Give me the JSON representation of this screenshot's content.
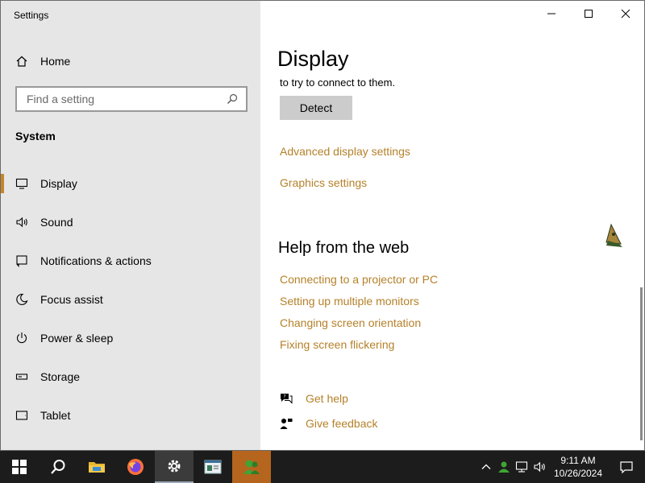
{
  "window": {
    "title": "Settings"
  },
  "sidebar": {
    "home_label": "Home",
    "search_placeholder": "Find a setting",
    "section_label": "System",
    "items": [
      {
        "label": "Display",
        "icon": "monitor-icon",
        "active": true
      },
      {
        "label": "Sound",
        "icon": "speaker-icon"
      },
      {
        "label": "Notifications & actions",
        "icon": "notification-icon"
      },
      {
        "label": "Focus assist",
        "icon": "moon-icon"
      },
      {
        "label": "Power & sleep",
        "icon": "power-icon"
      },
      {
        "label": "Storage",
        "icon": "storage-icon"
      },
      {
        "label": "Tablet",
        "icon": "tablet-icon"
      }
    ]
  },
  "main": {
    "heading": "Display",
    "intro_tail": "to try to connect to them.",
    "detect_label": "Detect",
    "links": [
      "Advanced display settings",
      "Graphics settings"
    ],
    "help_heading": "Help from the web",
    "help_links": [
      "Connecting to a projector or PC",
      "Setting up multiple monitors",
      "Changing screen orientation",
      "Fixing screen flickering"
    ],
    "get_help": "Get help",
    "give_feedback": "Give feedback"
  },
  "taskbar": {
    "time": "9:11 AM",
    "date": "10/26/2024"
  },
  "colors": {
    "accent": "#c5862b",
    "link": "#b5812a",
    "sidebar_bg": "#e6e6e6"
  }
}
